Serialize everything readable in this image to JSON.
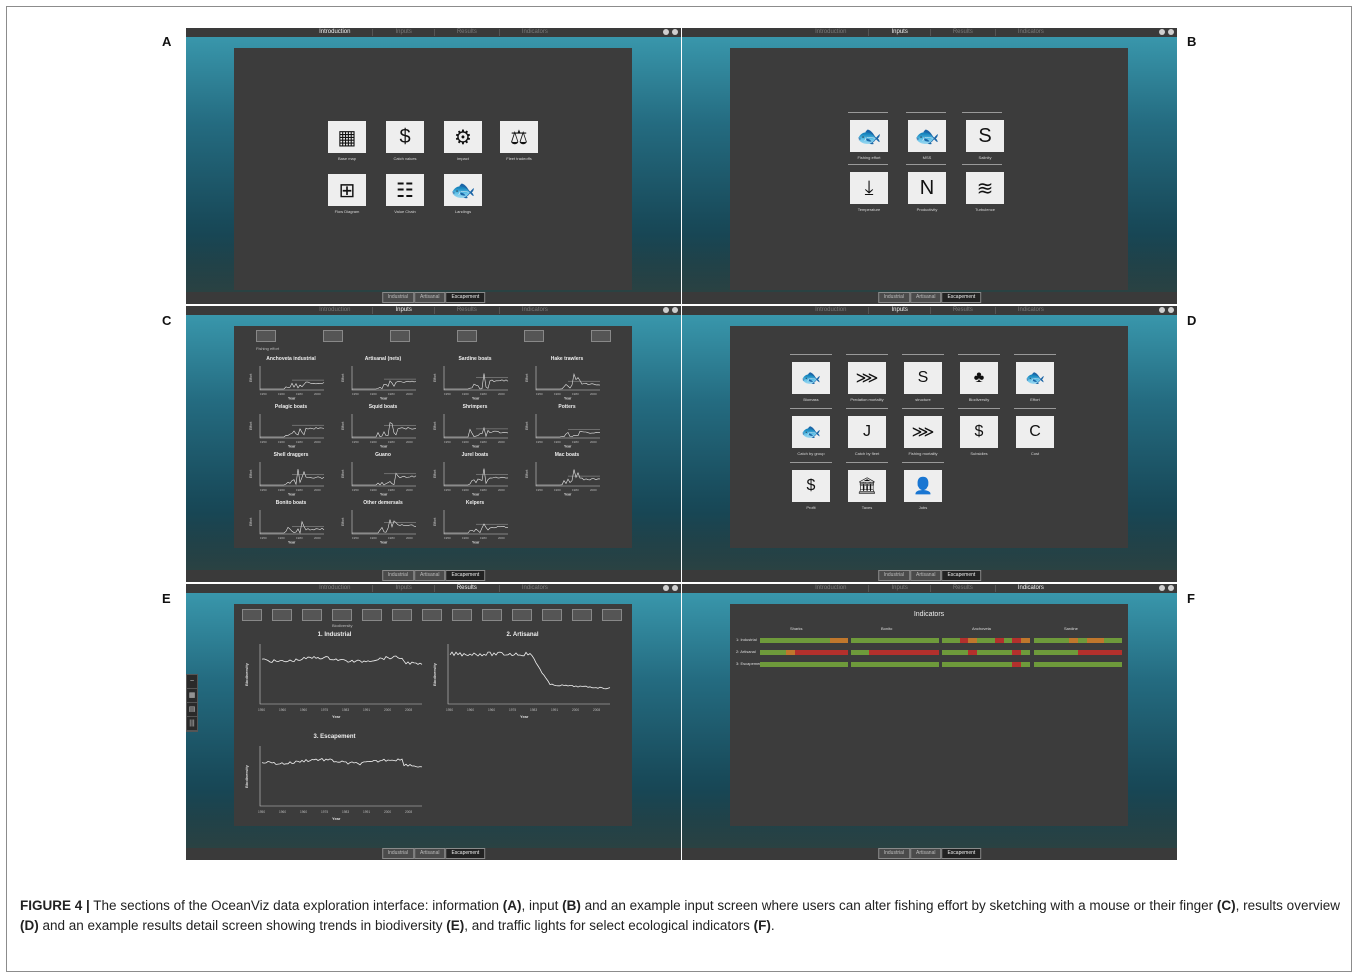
{
  "panel_labels": {
    "a": "A",
    "b": "B",
    "c": "C",
    "d": "D",
    "e": "E",
    "f": "F"
  },
  "nav_tabs": [
    "Introduction",
    "Inputs",
    "Results",
    "Indicators"
  ],
  "scenario_tabs": [
    "Industrial",
    "Artisanal",
    "Escapement"
  ],
  "panel_a": {
    "icons": [
      {
        "label": "Base map",
        "icon": "map-icon"
      },
      {
        "label": "Catch values",
        "icon": "dollar-icon"
      },
      {
        "label": "impact",
        "icon": "gears-icon"
      },
      {
        "label": "Fleet tradeoffs",
        "icon": "scale-icon"
      },
      {
        "label": "Flow Diagram",
        "icon": "flow-diagram-icon"
      },
      {
        "label": "Value Chain",
        "icon": "value-chain-icon"
      },
      {
        "label": "Landings",
        "icon": "fish-hook-icon"
      }
    ]
  },
  "panel_b": {
    "icons": [
      {
        "label": "Fishing effort",
        "icon": "fish-hook-icon"
      },
      {
        "label": "MSS",
        "icon": "fish-hook-icon"
      },
      {
        "label": "Salinity",
        "icon": "salinity-icon"
      },
      {
        "label": "Temperature",
        "icon": "temperature-icon"
      },
      {
        "label": "Productivity",
        "icon": "productivity-icon"
      },
      {
        "label": "Turbulence",
        "icon": "turbulence-icon"
      }
    ]
  },
  "panel_c": {
    "top_label": "Fishing effort",
    "ylabel": "Effort",
    "xlabel": "Year",
    "xticks": [
      "1950",
      "1960",
      "1983",
      "2000"
    ],
    "charts": [
      "Anchoveta industrial",
      "Artisanal (nets)",
      "Sardine boats",
      "Hake trawlers",
      "Pelagic boats",
      "Squid boats",
      "Shrimpers",
      "Potters",
      "Shell draggers",
      "Guano",
      "Jurel boats",
      "Mac boats",
      "Bonito boats",
      "Other demersals",
      "Kelpers"
    ]
  },
  "panel_d": {
    "icons": [
      {
        "label": "Biomass",
        "icon": "fish-school-icon"
      },
      {
        "label": "Predation mortality",
        "icon": "fish-skeleton-icon"
      },
      {
        "label": "structure",
        "icon": "structure-icon"
      },
      {
        "label": "Biodiversity",
        "icon": "biodiversity-icon"
      },
      {
        "label": "Effort",
        "icon": "fish-hook-icon"
      },
      {
        "label": "Catch by group",
        "icon": "fish-hook-icon"
      },
      {
        "label": "Catch by fleet",
        "icon": "hook-icon"
      },
      {
        "label": "Fishing mortality",
        "icon": "fish-skeleton-icon"
      },
      {
        "label": "Subsidies",
        "icon": "money-icon"
      },
      {
        "label": "Cost",
        "icon": "cost-chart-icon"
      },
      {
        "label": "Profit",
        "icon": "dollar-sign-icon"
      },
      {
        "label": "Taxes",
        "icon": "bank-icon"
      },
      {
        "label": "Jobs",
        "icon": "people-icon"
      }
    ]
  },
  "panel_e": {
    "top_label": "Biodiversity",
    "ylabel": "Biodiversity",
    "xlabel": "Year",
    "xticks": [
      "1950",
      "1960",
      "1960",
      "1975",
      "1983",
      "1991",
      "2000",
      "2008"
    ],
    "charts": [
      "1. Industrial",
      "2. Artisanal",
      "3. Escapement"
    ]
  },
  "panel_f": {
    "title": "Indicators",
    "columns": [
      "Sharks",
      "Bonito",
      "Anchoveta",
      "Sardine"
    ],
    "rows": [
      "1: Industrial",
      "2: Artisanal",
      "3: Escapement"
    ],
    "colors": {
      "green": "#6e9a3b",
      "red": "#b3302c",
      "orange": "#c0772c"
    }
  },
  "caption": {
    "lead": "FIGURE 4 |",
    "t1": " The sections of the OceanViz data exploration interface: information ",
    "a": "(A)",
    "t2": ", input ",
    "b": "(B)",
    "t3": " and an example input screen where users can alter fishing effort by sketching with a mouse or their finger ",
    "c": "(C)",
    "t4": ", results overview ",
    "d": "(D)",
    "t5": " and an example results detail screen showing trends in biodiversity ",
    "e": "(E)",
    "t6": ", and traffic lights for select ecological indicators ",
    "f": "(F)",
    "t7": "."
  }
}
